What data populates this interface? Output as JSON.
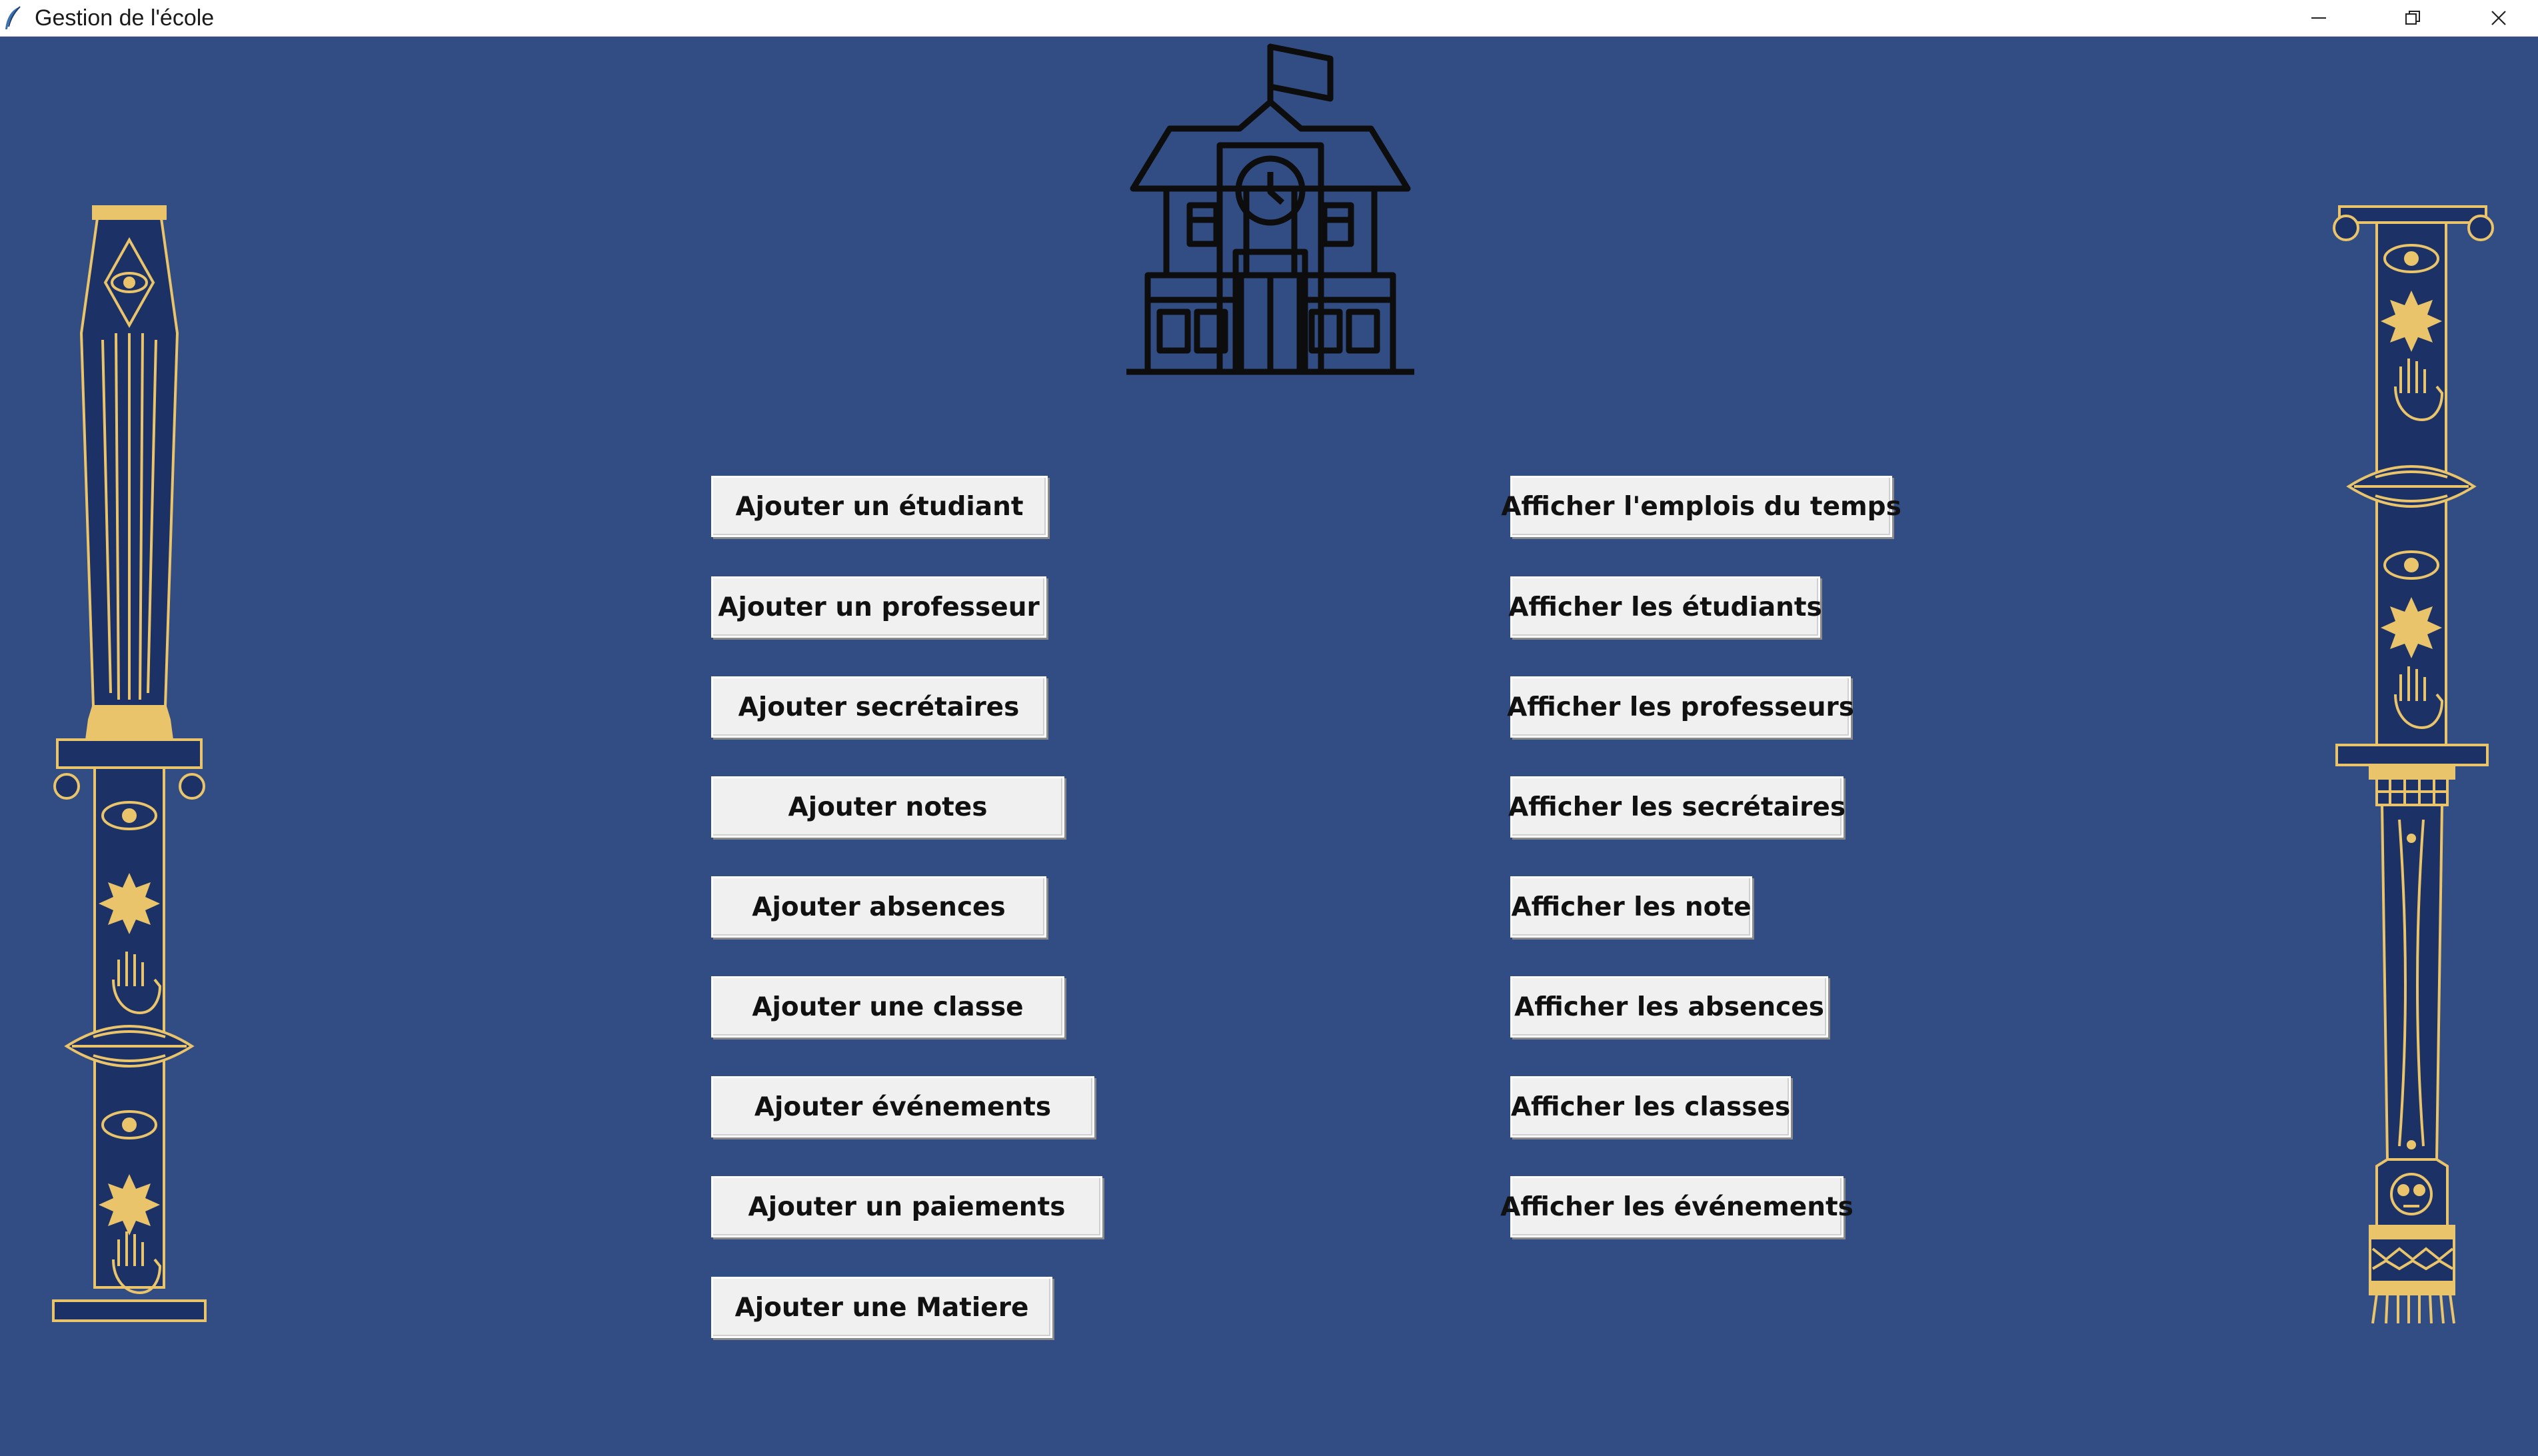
{
  "window": {
    "title": "Gestion de l'école",
    "icon": "feather-icon",
    "controls": [
      "minimize-icon",
      "restore-icon",
      "close-icon"
    ]
  },
  "header_icon": "school-building-icon",
  "decorations": [
    "ornamental-column-left",
    "ornamental-column-right"
  ],
  "colors": {
    "background": "#324d83",
    "ornament_gold": "#e9c46a",
    "ornament_navy": "#1c3166",
    "button_face": "#f0f0f0"
  },
  "actions_add": [
    {
      "label": "Ajouter un étudiant"
    },
    {
      "label": "Ajouter un professeur"
    },
    {
      "label": "Ajouter secrétaires"
    },
    {
      "label": "Ajouter notes"
    },
    {
      "label": "Ajouter absences"
    },
    {
      "label": "Ajouter une classe"
    },
    {
      "label": "Ajouter événements"
    },
    {
      "label": "Ajouter un paiements"
    },
    {
      "label": "Ajouter une Matiere"
    }
  ],
  "actions_show": [
    {
      "label": "Afficher l'emplois du temps"
    },
    {
      "label": "Afficher les étudiants"
    },
    {
      "label": "Afficher les professeurs"
    },
    {
      "label": "Afficher les secrétaires"
    },
    {
      "label": "Afficher les note"
    },
    {
      "label": "Afficher les absences"
    },
    {
      "label": "Afficher les classes"
    },
    {
      "label": "Afficher les événements"
    }
  ]
}
